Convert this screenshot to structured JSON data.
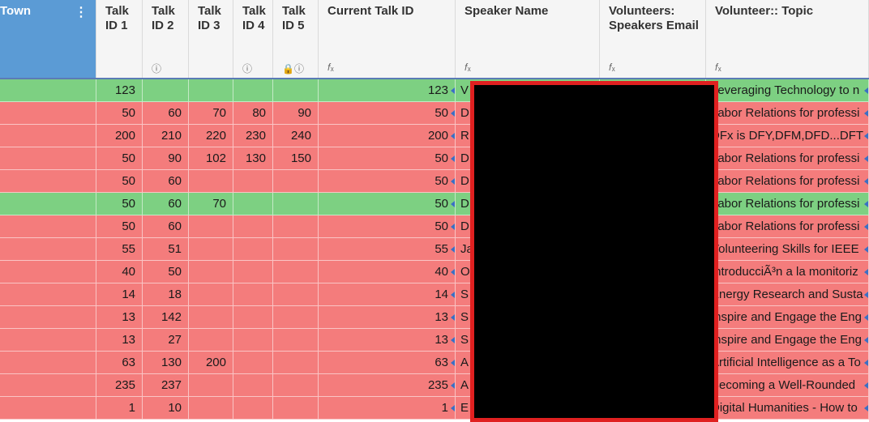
{
  "columns": [
    {
      "key": "town",
      "label": "Town",
      "icon": ""
    },
    {
      "key": "t1",
      "label": "Talk\nID 1",
      "icon": ""
    },
    {
      "key": "t2",
      "label": "Talk\nID 2",
      "icon": "ⓘ"
    },
    {
      "key": "t3",
      "label": "Talk\nID 3",
      "icon": ""
    },
    {
      "key": "t4",
      "label": "Talk\nID 4",
      "icon": "ⓘ"
    },
    {
      "key": "t5",
      "label": "Talk\nID 5",
      "icon": "🔒ⓘ"
    },
    {
      "key": "cur",
      "label": "Current Talk ID",
      "icon": "𝑓ₓ"
    },
    {
      "key": "spk",
      "label": "Speaker Name",
      "icon": "𝑓ₓ"
    },
    {
      "key": "email",
      "label": "Volunteers:\nSpeakers Email",
      "icon": "𝑓ₓ"
    },
    {
      "key": "topic",
      "label": "Volunteer:: Topic",
      "icon": "𝑓ₓ"
    }
  ],
  "colors": {
    "green": "#7dd082",
    "red": "#f47c7c"
  },
  "rows": [
    {
      "c": "green",
      "t1": "123",
      "t2": "",
      "t3": "",
      "t4": "",
      "t5": "",
      "cur": "123",
      "spk": "V",
      "topic": "Leveraging Technology to n"
    },
    {
      "c": "red",
      "t1": "50",
      "t2": "60",
      "t3": "70",
      "t4": "80",
      "t5": "90",
      "cur": "50",
      "spk": "D",
      "topic": "Labor Relations for professi"
    },
    {
      "c": "red",
      "t1": "200",
      "t2": "210",
      "t3": "220",
      "t4": "230",
      "t5": "240",
      "cur": "200",
      "spk": "R",
      "topic": "DFx is DFY,DFM,DFD...DFT"
    },
    {
      "c": "red",
      "t1": "50",
      "t2": "90",
      "t3": "102",
      "t4": "130",
      "t5": "150",
      "cur": "50",
      "spk": "D",
      "topic": "Labor Relations for professi"
    },
    {
      "c": "red",
      "t1": "50",
      "t2": "60",
      "t3": "",
      "t4": "",
      "t5": "",
      "cur": "50",
      "spk": "D",
      "topic": "Labor Relations for professi"
    },
    {
      "c": "green",
      "t1": "50",
      "t2": "60",
      "t3": "70",
      "t4": "",
      "t5": "",
      "cur": "50",
      "spk": "D",
      "topic": "Labor Relations for professi"
    },
    {
      "c": "red",
      "t1": "50",
      "t2": "60",
      "t3": "",
      "t4": "",
      "t5": "",
      "cur": "50",
      "spk": "D",
      "topic": "Labor Relations for professi"
    },
    {
      "c": "red",
      "t1": "55",
      "t2": "51",
      "t3": "",
      "t4": "",
      "t5": "",
      "cur": "55",
      "spk": "Ja",
      "topic": "Volunteering Skills for IEEE"
    },
    {
      "c": "red",
      "t1": "40",
      "t2": "50",
      "t3": "",
      "t4": "",
      "t5": "",
      "cur": "40",
      "spk": "O",
      "topic": "IntroducciÃ³n a la monitoriz"
    },
    {
      "c": "red",
      "t1": "14",
      "t2": "18",
      "t3": "",
      "t4": "",
      "t5": "",
      "cur": "14",
      "spk": "S",
      "topic": "Energy Research and Susta"
    },
    {
      "c": "red",
      "t1": "13",
      "t2": "142",
      "t3": "",
      "t4": "",
      "t5": "",
      "cur": "13",
      "spk": "S",
      "topic": "Inspire and Engage the Eng"
    },
    {
      "c": "red",
      "t1": "13",
      "t2": "27",
      "t3": "",
      "t4": "",
      "t5": "",
      "cur": "13",
      "spk": "S",
      "topic": "Inspire and Engage the Eng"
    },
    {
      "c": "red",
      "t1": "63",
      "t2": "130",
      "t3": "200",
      "t4": "",
      "t5": "",
      "cur": "63",
      "spk": "A",
      "topic": "Artificial Intelligence as a To"
    },
    {
      "c": "red",
      "t1": "235",
      "t2": "237",
      "t3": "",
      "t4": "",
      "t5": "",
      "cur": "235",
      "spk": "A",
      "topic": "Becoming a Well-Rounded"
    },
    {
      "c": "red",
      "t1": "1",
      "t2": "10",
      "t3": "",
      "t4": "",
      "t5": "",
      "cur": "1",
      "spk": "E",
      "topic": "Digital Humanities - How to"
    }
  ]
}
